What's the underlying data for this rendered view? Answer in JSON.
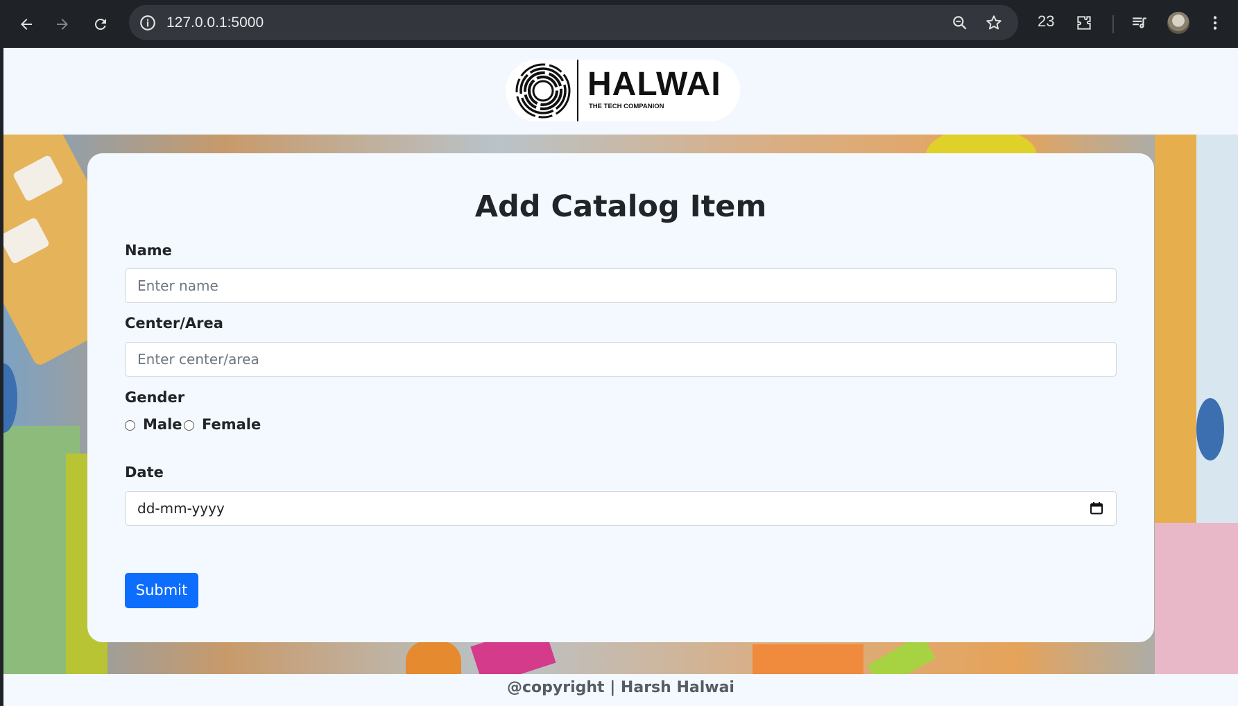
{
  "browser": {
    "url": "127.0.0.1:5000",
    "tab_count": "23"
  },
  "header": {
    "logo_name": "HALWAI",
    "logo_tagline": "THE TECH COMPANION"
  },
  "form": {
    "title": "Add Catalog Item",
    "name_label": "Name",
    "name_placeholder": "Enter name",
    "area_label": "Center/Area",
    "area_placeholder": "Enter center/area",
    "gender_label": "Gender",
    "gender_options": [
      "Male",
      "Female"
    ],
    "date_label": "Date",
    "date_placeholder": "dd-mm-yyyy",
    "submit_label": "Submit"
  },
  "footer": {
    "text": "@copyright | Harsh Halwai"
  },
  "colors": {
    "primary": "#0d6efd",
    "chrome_bg": "#1f2226",
    "page_bg": "#f4f9ff"
  }
}
